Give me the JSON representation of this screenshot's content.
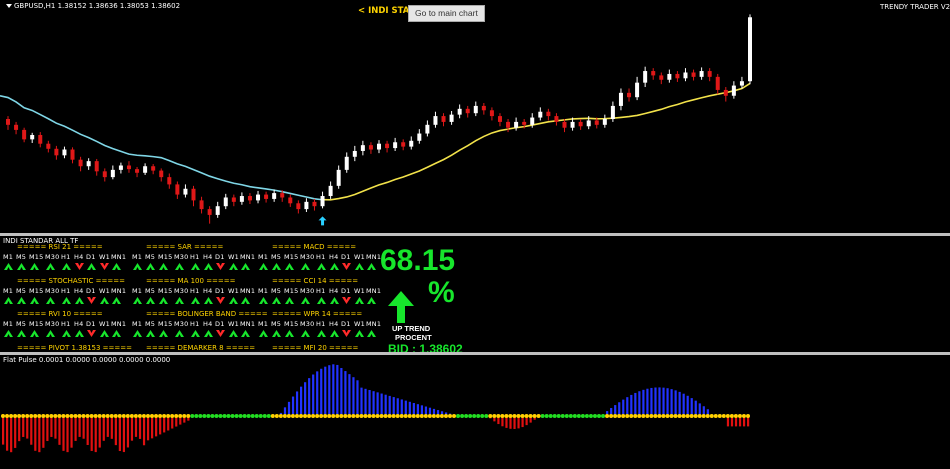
{
  "main": {
    "symbol_info": "GBPUSD,H1  1.38152 1.38636 1.38053 1.38602",
    "center_title": "< INDI STANDAR ALL TF",
    "right_title": "TRENDY TRADER V2",
    "tooltip": "Go to main chart",
    "candles": [
      {
        "o": 1.372,
        "c": 1.3712,
        "h": 1.3724,
        "l": 1.3705
      },
      {
        "o": 1.3712,
        "c": 1.3705,
        "h": 1.3716,
        "l": 1.3699
      },
      {
        "o": 1.3705,
        "c": 1.3692,
        "h": 1.3708,
        "l": 1.3688
      },
      {
        "o": 1.3692,
        "c": 1.3698,
        "h": 1.3701,
        "l": 1.3687
      },
      {
        "o": 1.3698,
        "c": 1.3686,
        "h": 1.3702,
        "l": 1.3681
      },
      {
        "o": 1.3686,
        "c": 1.3679,
        "h": 1.369,
        "l": 1.3674
      },
      {
        "o": 1.3679,
        "c": 1.367,
        "h": 1.3683,
        "l": 1.3664
      },
      {
        "o": 1.367,
        "c": 1.3678,
        "h": 1.3682,
        "l": 1.3666
      },
      {
        "o": 1.3678,
        "c": 1.3664,
        "h": 1.3681,
        "l": 1.3659
      },
      {
        "o": 1.3664,
        "c": 1.3655,
        "h": 1.3668,
        "l": 1.3648
      },
      {
        "o": 1.3655,
        "c": 1.3662,
        "h": 1.3666,
        "l": 1.365
      },
      {
        "o": 1.3662,
        "c": 1.3648,
        "h": 1.3665,
        "l": 1.3642
      },
      {
        "o": 1.3648,
        "c": 1.364,
        "h": 1.3652,
        "l": 1.3634
      },
      {
        "o": 1.364,
        "c": 1.365,
        "h": 1.3656,
        "l": 1.3637
      },
      {
        "o": 1.365,
        "c": 1.3656,
        "h": 1.366,
        "l": 1.3645
      },
      {
        "o": 1.3656,
        "c": 1.3651,
        "h": 1.3662,
        "l": 1.3646
      },
      {
        "o": 1.3651,
        "c": 1.3646,
        "h": 1.3654,
        "l": 1.364
      },
      {
        "o": 1.3646,
        "c": 1.3655,
        "h": 1.3659,
        "l": 1.3643
      },
      {
        "o": 1.3655,
        "c": 1.3649,
        "h": 1.3658,
        "l": 1.3644
      },
      {
        "o": 1.3649,
        "c": 1.364,
        "h": 1.3652,
        "l": 1.3634
      },
      {
        "o": 1.364,
        "c": 1.363,
        "h": 1.3645,
        "l": 1.3624
      },
      {
        "o": 1.363,
        "c": 1.3616,
        "h": 1.3634,
        "l": 1.361
      },
      {
        "o": 1.3616,
        "c": 1.3624,
        "h": 1.363,
        "l": 1.3612
      },
      {
        "o": 1.3624,
        "c": 1.3608,
        "h": 1.3628,
        "l": 1.36
      },
      {
        "o": 1.3608,
        "c": 1.3596,
        "h": 1.3613,
        "l": 1.359
      },
      {
        "o": 1.3596,
        "c": 1.3588,
        "h": 1.36,
        "l": 1.3576
      },
      {
        "o": 1.3588,
        "c": 1.36,
        "h": 1.3606,
        "l": 1.3584
      },
      {
        "o": 1.36,
        "c": 1.3612,
        "h": 1.3617,
        "l": 1.3596
      },
      {
        "o": 1.3612,
        "c": 1.3606,
        "h": 1.3616,
        "l": 1.36
      },
      {
        "o": 1.3606,
        "c": 1.3614,
        "h": 1.3619,
        "l": 1.3602
      },
      {
        "o": 1.3614,
        "c": 1.3608,
        "h": 1.3618,
        "l": 1.3603
      },
      {
        "o": 1.3608,
        "c": 1.3616,
        "h": 1.3621,
        "l": 1.3604
      },
      {
        "o": 1.3616,
        "c": 1.361,
        "h": 1.362,
        "l": 1.3605
      },
      {
        "o": 1.361,
        "c": 1.3618,
        "h": 1.3623,
        "l": 1.3606
      },
      {
        "o": 1.3618,
        "c": 1.3612,
        "h": 1.3622,
        "l": 1.3606
      },
      {
        "o": 1.3612,
        "c": 1.3604,
        "h": 1.3616,
        "l": 1.3599
      },
      {
        "o": 1.3604,
        "c": 1.3596,
        "h": 1.3608,
        "l": 1.359
      },
      {
        "o": 1.3596,
        "c": 1.3606,
        "h": 1.3611,
        "l": 1.3592
      },
      {
        "o": 1.3606,
        "c": 1.36,
        "h": 1.361,
        "l": 1.3594
      },
      {
        "o": 1.36,
        "c": 1.3614,
        "h": 1.362,
        "l": 1.3597
      },
      {
        "o": 1.3614,
        "c": 1.3628,
        "h": 1.3634,
        "l": 1.361
      },
      {
        "o": 1.3628,
        "c": 1.365,
        "h": 1.3656,
        "l": 1.3624
      },
      {
        "o": 1.365,
        "c": 1.3668,
        "h": 1.3674,
        "l": 1.3646
      },
      {
        "o": 1.3668,
        "c": 1.3676,
        "h": 1.3683,
        "l": 1.3662
      },
      {
        "o": 1.3676,
        "c": 1.3684,
        "h": 1.369,
        "l": 1.367
      },
      {
        "o": 1.3684,
        "c": 1.3678,
        "h": 1.3688,
        "l": 1.3672
      },
      {
        "o": 1.3678,
        "c": 1.3686,
        "h": 1.3691,
        "l": 1.3673
      },
      {
        "o": 1.3686,
        "c": 1.368,
        "h": 1.369,
        "l": 1.3674
      },
      {
        "o": 1.368,
        "c": 1.3688,
        "h": 1.3694,
        "l": 1.3676
      },
      {
        "o": 1.3688,
        "c": 1.3682,
        "h": 1.3692,
        "l": 1.3677
      },
      {
        "o": 1.3682,
        "c": 1.369,
        "h": 1.3696,
        "l": 1.3678
      },
      {
        "o": 1.369,
        "c": 1.37,
        "h": 1.3706,
        "l": 1.3686
      },
      {
        "o": 1.37,
        "c": 1.3712,
        "h": 1.3718,
        "l": 1.3696
      },
      {
        "o": 1.3712,
        "c": 1.3724,
        "h": 1.373,
        "l": 1.3708
      },
      {
        "o": 1.3724,
        "c": 1.3716,
        "h": 1.3728,
        "l": 1.371
      },
      {
        "o": 1.3716,
        "c": 1.3726,
        "h": 1.3731,
        "l": 1.3712
      },
      {
        "o": 1.3726,
        "c": 1.3734,
        "h": 1.374,
        "l": 1.3721
      },
      {
        "o": 1.3734,
        "c": 1.3728,
        "h": 1.3738,
        "l": 1.3722
      },
      {
        "o": 1.3728,
        "c": 1.3738,
        "h": 1.3744,
        "l": 1.3724
      },
      {
        "o": 1.3738,
        "c": 1.3732,
        "h": 1.3742,
        "l": 1.3726
      },
      {
        "o": 1.3732,
        "c": 1.3724,
        "h": 1.3736,
        "l": 1.3718
      },
      {
        "o": 1.3724,
        "c": 1.3716,
        "h": 1.3728,
        "l": 1.371
      },
      {
        "o": 1.3716,
        "c": 1.3708,
        "h": 1.372,
        "l": 1.3702
      },
      {
        "o": 1.3708,
        "c": 1.3716,
        "h": 1.3722,
        "l": 1.3704
      },
      {
        "o": 1.3716,
        "c": 1.3712,
        "h": 1.372,
        "l": 1.3707
      },
      {
        "o": 1.3712,
        "c": 1.3722,
        "h": 1.3728,
        "l": 1.3708
      },
      {
        "o": 1.3722,
        "c": 1.373,
        "h": 1.3736,
        "l": 1.3718
      },
      {
        "o": 1.373,
        "c": 1.3724,
        "h": 1.3734,
        "l": 1.3718
      },
      {
        "o": 1.3724,
        "c": 1.3716,
        "h": 1.3728,
        "l": 1.3711
      },
      {
        "o": 1.3716,
        "c": 1.3708,
        "h": 1.372,
        "l": 1.3702
      },
      {
        "o": 1.3708,
        "c": 1.3716,
        "h": 1.3722,
        "l": 1.3704
      },
      {
        "o": 1.3716,
        "c": 1.371,
        "h": 1.372,
        "l": 1.3705
      },
      {
        "o": 1.371,
        "c": 1.3718,
        "h": 1.3724,
        "l": 1.3706
      },
      {
        "o": 1.3718,
        "c": 1.3712,
        "h": 1.3722,
        "l": 1.3707
      },
      {
        "o": 1.3712,
        "c": 1.372,
        "h": 1.3726,
        "l": 1.3708
      },
      {
        "o": 1.372,
        "c": 1.3738,
        "h": 1.3744,
        "l": 1.3716
      },
      {
        "o": 1.3738,
        "c": 1.3756,
        "h": 1.3762,
        "l": 1.3732
      },
      {
        "o": 1.3756,
        "c": 1.375,
        "h": 1.3762,
        "l": 1.3744
      },
      {
        "o": 1.375,
        "c": 1.377,
        "h": 1.3778,
        "l": 1.3746
      },
      {
        "o": 1.377,
        "c": 1.3786,
        "h": 1.3792,
        "l": 1.3764
      },
      {
        "o": 1.3786,
        "c": 1.378,
        "h": 1.379,
        "l": 1.3774
      },
      {
        "o": 1.378,
        "c": 1.3774,
        "h": 1.3784,
        "l": 1.3768
      },
      {
        "o": 1.3774,
        "c": 1.3782,
        "h": 1.3788,
        "l": 1.377
      },
      {
        "o": 1.3782,
        "c": 1.3776,
        "h": 1.3786,
        "l": 1.3771
      },
      {
        "o": 1.3776,
        "c": 1.3784,
        "h": 1.379,
        "l": 1.3772
      },
      {
        "o": 1.3784,
        "c": 1.3778,
        "h": 1.3788,
        "l": 1.3773
      },
      {
        "o": 1.3778,
        "c": 1.3786,
        "h": 1.3791,
        "l": 1.3774
      },
      {
        "o": 1.3786,
        "c": 1.3778,
        "h": 1.379,
        "l": 1.3772
      },
      {
        "o": 1.3778,
        "c": 1.376,
        "h": 1.3782,
        "l": 1.3754
      },
      {
        "o": 1.376,
        "c": 1.3752,
        "h": 1.3764,
        "l": 1.3744
      },
      {
        "o": 1.3752,
        "c": 1.3766,
        "h": 1.3772,
        "l": 1.3748
      },
      {
        "o": 1.3766,
        "c": 1.3772,
        "h": 1.3778,
        "l": 1.3762
      },
      {
        "o": 1.3772,
        "c": 1.386,
        "h": 1.3864,
        "l": 1.3768
      }
    ],
    "signal_arrow": "up"
  },
  "panel": {
    "title": "INDI STANDAR ALL TF",
    "timeframes": [
      "M1",
      "M5",
      "M15",
      "M30",
      "H1",
      "H4",
      "D1",
      "W1",
      "MN1"
    ],
    "columns": [
      {
        "blocks": [
          {
            "header": "===== RSI 21 =====",
            "arrows": [
              "g",
              "g",
              "g",
              "g",
              "g",
              "r",
              "g",
              "r",
              "g"
            ]
          },
          {
            "header": "===== STOCHASTIC =====",
            "arrows": [
              "g",
              "g",
              "g",
              "g",
              "g",
              "g",
              "r",
              "g",
              "g"
            ]
          },
          {
            "header": "===== RVI 10 =====",
            "arrows": [
              "g",
              "g",
              "g",
              "g",
              "g",
              "g",
              "r",
              "g",
              "g"
            ]
          },
          {
            "header": "===== PIVOT 1.38153 =====",
            "arrows": []
          }
        ]
      },
      {
        "blocks": [
          {
            "header": "===== SAR =====",
            "arrows": [
              "g",
              "g",
              "g",
              "g",
              "g",
              "g",
              "r",
              "g",
              "g"
            ]
          },
          {
            "header": "===== MA 100 =====",
            "arrows": [
              "g",
              "g",
              "g",
              "g",
              "g",
              "g",
              "r",
              "g",
              "g"
            ]
          },
          {
            "header": "===== BOLINGER BAND =====",
            "arrows": [
              "g",
              "g",
              "g",
              "g",
              "g",
              "g",
              "r",
              "g",
              "g"
            ]
          },
          {
            "header": "===== DEMARKER 8 =====",
            "arrows": []
          }
        ]
      },
      {
        "blocks": [
          {
            "header": "===== MACD =====",
            "arrows": [
              "g",
              "g",
              "g",
              "g",
              "g",
              "g",
              "r",
              "g",
              "g"
            ]
          },
          {
            "header": "===== CCI 14 =====",
            "arrows": [
              "g",
              "g",
              "g",
              "g",
              "g",
              "g",
              "r",
              "g",
              "g"
            ]
          },
          {
            "header": "===== WPR 14 =====",
            "arrows": [
              "g",
              "g",
              "g",
              "g",
              "g",
              "g",
              "r",
              "g",
              "g"
            ]
          },
          {
            "header": "===== MFI 20 =====",
            "arrows": []
          }
        ]
      }
    ],
    "percent_value": "68.15",
    "percent_sign": "%",
    "trend_label": "UP TREND",
    "procent_label": "PROCENT",
    "bid_label": "BID : 1.38602",
    "colors": {
      "up": "#17e62c",
      "down": "#ff2a2a",
      "header": "#ffd400"
    }
  },
  "oscillator": {
    "title": "Flat Pulse 0.0001 0.0000 0.0000 0.0000 0.0000",
    "colors": {
      "positive": "#2233ff",
      "negative": "#e01010",
      "dot_flat": "#ffd000",
      "dot_signal": "#22dd22"
    }
  }
}
